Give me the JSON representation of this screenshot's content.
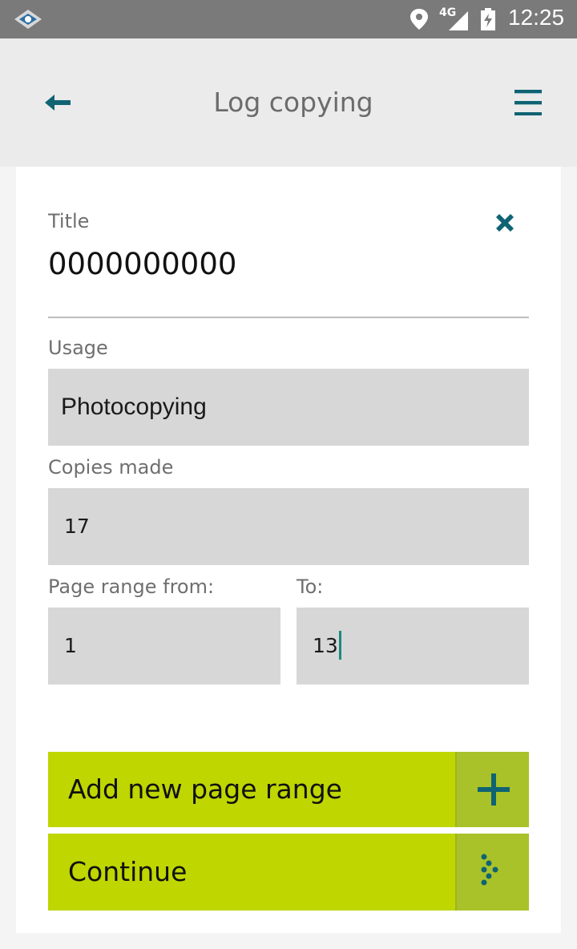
{
  "status_bar": {
    "network": "4G",
    "time": "12:25"
  },
  "app_bar": {
    "title": "Log copying"
  },
  "form": {
    "title_label": "Title",
    "title_value": "0000000000",
    "usage_label": "Usage",
    "usage_value": "Photocopying",
    "copies_label": "Copies made",
    "copies_value": "17",
    "page_from_label": "Page range from:",
    "page_from_value": "1",
    "page_to_label": "To:",
    "page_to_value": "13"
  },
  "buttons": {
    "add_range_label": "Add new page range",
    "continue_label": "Continue"
  },
  "colors": {
    "accent": "#0f6373",
    "button": "#bfd600",
    "button_icon_bg": "#a9c22a"
  },
  "icons": {
    "back": "arrow-left-icon",
    "menu": "hamburger-menu-icon",
    "clear": "close-x-icon",
    "add": "plus-icon",
    "continue": "dotted-chevron-right-icon"
  }
}
